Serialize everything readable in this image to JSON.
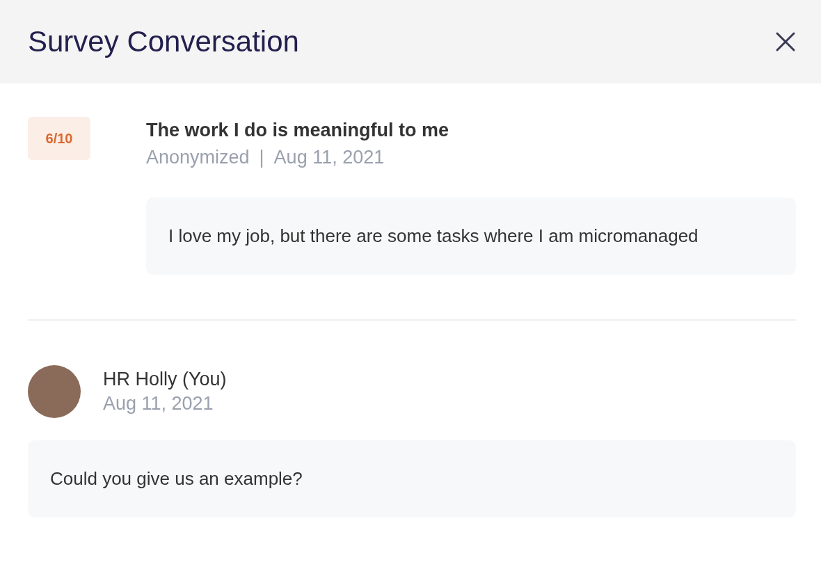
{
  "header": {
    "title": "Survey Conversation"
  },
  "response": {
    "score": "6/10",
    "question": "The work I do is meaningful to me",
    "author": "Anonymized",
    "separator": "|",
    "date": "Aug 11, 2021",
    "answer": "I love my job, but there are some tasks where I am micromanaged"
  },
  "reply": {
    "name": "HR Holly (You)",
    "date": "Aug 11, 2021",
    "text": "Could you give us an example?"
  }
}
